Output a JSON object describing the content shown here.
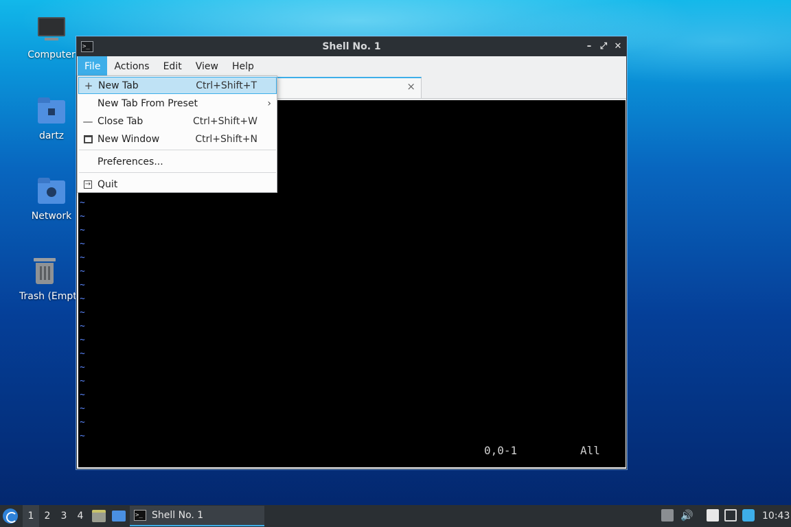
{
  "desktop": {
    "icons": [
      {
        "label": "Computer",
        "icon": "computer-icon"
      },
      {
        "label": "dartz",
        "icon": "home-folder-icon"
      },
      {
        "label": "Network",
        "icon": "network-folder-icon"
      },
      {
        "label": "Trash (Empty)",
        "icon": "trash-icon"
      }
    ]
  },
  "window": {
    "title": "Shell No. 1",
    "menu": [
      "File",
      "Actions",
      "Edit",
      "View",
      "Help"
    ],
    "active_menu": "File",
    "tab": {
      "close": "×"
    },
    "terminal": {
      "tilde": "~",
      "position": "0,0-1",
      "scroll": "All"
    }
  },
  "file_menu": {
    "items": [
      {
        "label": "New Tab",
        "shortcut": "Ctrl+Shift+T",
        "icon": "plus-icon"
      },
      {
        "label": "New Tab From Preset",
        "shortcut": "",
        "submenu": true
      },
      {
        "label": "Close Tab",
        "shortcut": "Ctrl+Shift+W",
        "icon": "minus-icon"
      },
      {
        "label": "New Window",
        "shortcut": "Ctrl+Shift+N",
        "icon": "new-window-icon"
      },
      {
        "label": "Preferences...",
        "shortcut": ""
      },
      {
        "label": "Quit",
        "shortcut": "",
        "icon": "quit-icon"
      }
    ]
  },
  "taskbar": {
    "workspaces": [
      "1",
      "2",
      "3",
      "4"
    ],
    "active_workspace": "1",
    "task_label": "Shell No. 1",
    "clock": "10:43"
  },
  "colors": {
    "accent": "#3daee9",
    "titlebar": "#2b3035",
    "taskbar": "#2a2f33",
    "tilde": "#5b87ff"
  }
}
